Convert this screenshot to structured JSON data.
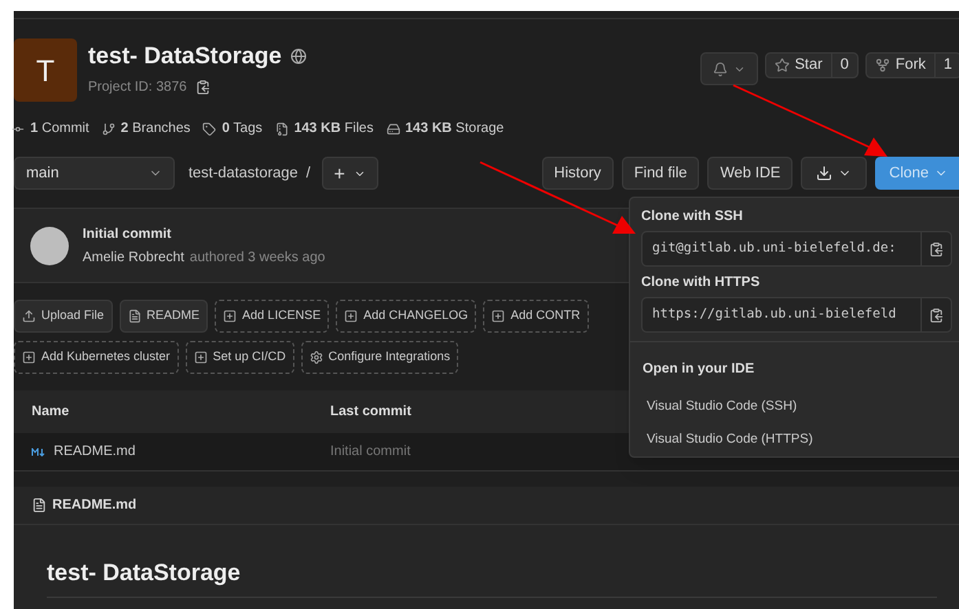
{
  "project": {
    "avatar_letter": "T",
    "title": "test- DataStorage",
    "project_id": "Project ID: 3876"
  },
  "header_actions": [
    {
      "kind": "notify"
    },
    {
      "kind": "counter",
      "label": "Star",
      "count": "0"
    },
    {
      "kind": "counter",
      "label": "Fork",
      "count": "1"
    }
  ],
  "stats": [
    {
      "kind": "commit",
      "text": "**1** Commit"
    },
    {
      "kind": "branch",
      "text": "**2** Branches"
    },
    {
      "kind": "tag",
      "text": "**0** Tags"
    },
    {
      "kind": "files",
      "text": "**143 KB** Files"
    },
    {
      "kind": "storage",
      "text": "**143 KB** Storage"
    }
  ],
  "branch": {
    "value": "main",
    "path": "test-datastorage",
    "separator": "/",
    "add": "+"
  },
  "toolbar": [
    {
      "kind": "text",
      "label": "History"
    },
    {
      "kind": "text",
      "label": "Find file"
    },
    {
      "kind": "text",
      "label": "Web IDE"
    },
    {
      "kind": "download"
    },
    {
      "kind": "clone",
      "label": "Clone"
    }
  ],
  "last_commit": {
    "title": "Initial commit",
    "author": "Amelie Robrecht",
    "meta": "authored 3 weeks ago"
  },
  "quick_actions": [
    [
      {
        "kind": "upload",
        "label": "Upload File"
      },
      {
        "kind": "file",
        "label": "README"
      },
      {
        "kind": "add",
        "label": "Add LICENSE"
      },
      {
        "kind": "add",
        "label": "Add CHANGELOG"
      },
      {
        "kind": "add",
        "label": "Add CONTR"
      }
    ],
    [
      {
        "kind": "add",
        "label": "Add Kubernetes cluster"
      },
      {
        "kind": "add",
        "label": "Set up CI/CD"
      },
      {
        "kind": "settings",
        "label": "Configure Integrations"
      }
    ]
  ],
  "table": {
    "columns": [
      "Name",
      "Last commit"
    ],
    "rows": [
      {
        "name": "README.md",
        "last_commit": "Initial commit"
      }
    ]
  },
  "readme": {
    "filename": "README.md",
    "heading": "test- DataStorage"
  },
  "clone_menu": {
    "sections": [
      {
        "title": "Clone with SSH",
        "url": "git@gitlab.ub.uni-bielefeld.de:"
      },
      {
        "title": "Clone with HTTPS",
        "url": "https://gitlab.ub.uni-bielefeld"
      }
    ],
    "ide_title": "Open in your IDE",
    "ide_items": [
      "Visual Studio Code (SSH)",
      "Visual Studio Code (HTTPS)"
    ]
  }
}
